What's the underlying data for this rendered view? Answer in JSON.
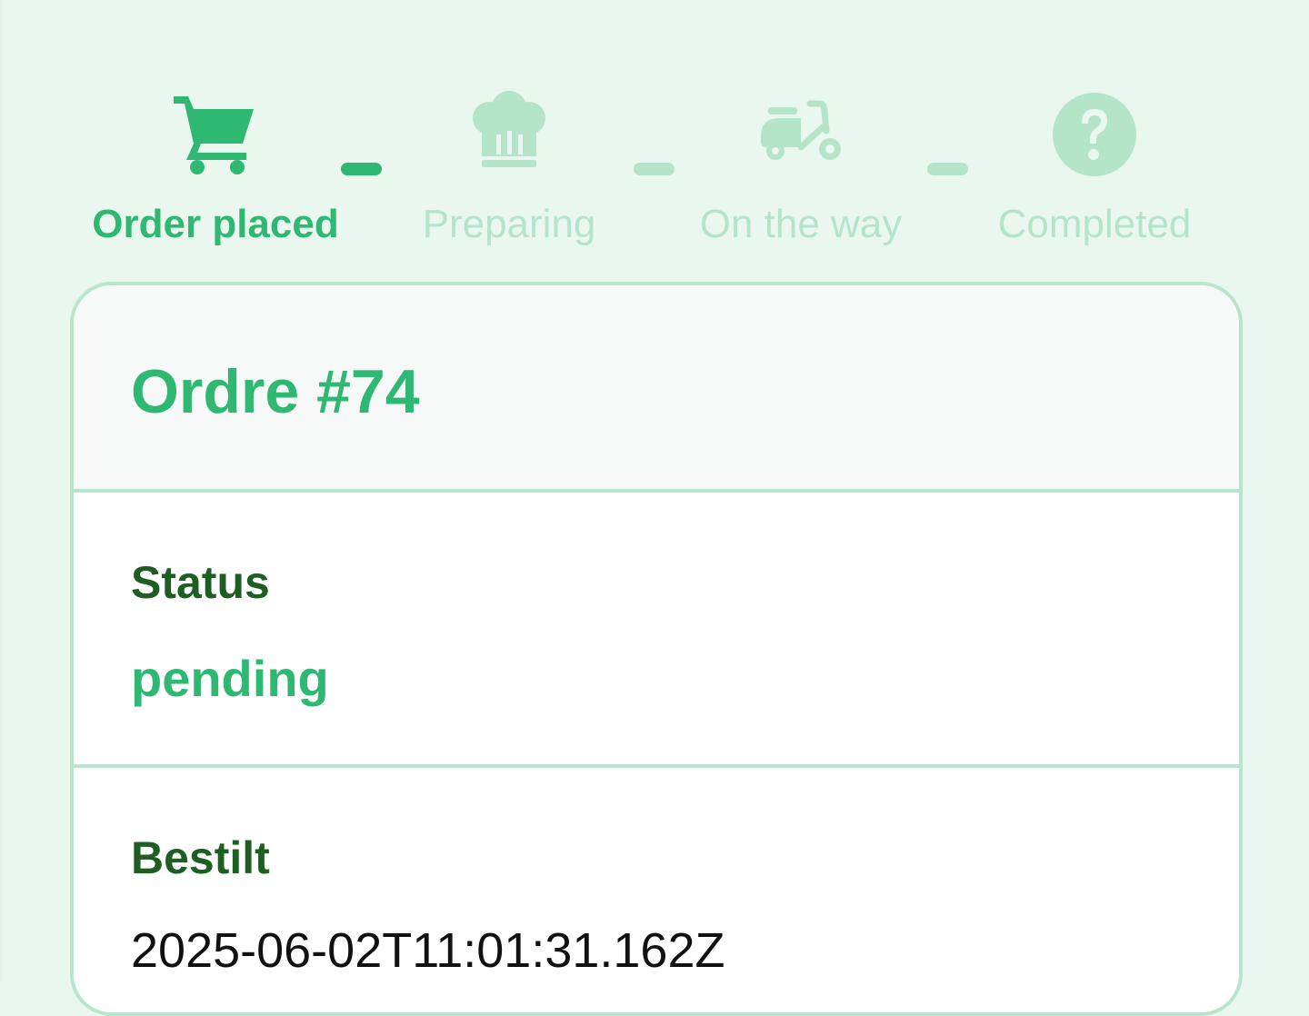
{
  "stepper": {
    "steps": [
      {
        "label": "Order placed",
        "icon": "cart-icon",
        "state": "active"
      },
      {
        "label": "Preparing",
        "icon": "chef-hat-icon",
        "state": "inactive"
      },
      {
        "label": "On the way",
        "icon": "scooter-icon",
        "state": "inactive"
      },
      {
        "label": "Completed",
        "icon": "question-circle-icon",
        "state": "inactive"
      }
    ]
  },
  "colors": {
    "accent": "#2eb872",
    "accent_light": "#b5e5c9",
    "label_dark": "#1e5e23",
    "background": "#eaf7ef",
    "card_border": "#b8e6cb"
  },
  "order": {
    "title": "Ordre #74",
    "status_label": "Status",
    "status_value": "pending",
    "ordered_label": "Bestilt",
    "ordered_value": "2025-06-02T11:01:31.162Z"
  }
}
